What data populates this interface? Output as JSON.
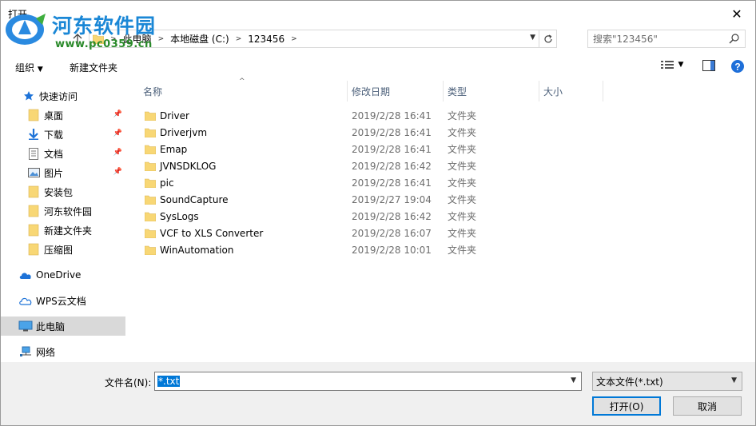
{
  "window": {
    "title": "打开",
    "close_glyph": "✕"
  },
  "watermark": {
    "name": "河东软件园",
    "url": "www.pc0359.cn"
  },
  "address": {
    "crumbs": [
      "此电脑",
      "本地磁盘 (C:)",
      "123456"
    ],
    "search_placeholder": "搜索\"123456\""
  },
  "toolbar": {
    "organize_label": "组织",
    "new_folder_label": "新建文件夹"
  },
  "sidebar": {
    "quick_access": "快速访问",
    "pinned": [
      {
        "label": "桌面",
        "icon": "folder-icon"
      },
      {
        "label": "下载",
        "icon": "download-icon"
      },
      {
        "label": "文档",
        "icon": "document-icon"
      },
      {
        "label": "图片",
        "icon": "picture-icon"
      }
    ],
    "folders": [
      "安装包",
      "河东软件园",
      "新建文件夹",
      "压缩图"
    ],
    "onedrive": "OneDrive",
    "wps": "WPS云文档",
    "this_pc": "此电脑",
    "network": "网络"
  },
  "columns": [
    "名称",
    "修改日期",
    "类型",
    "大小"
  ],
  "files": [
    {
      "name": "Driver",
      "date": "2019/2/28 16:41",
      "type": "文件夹"
    },
    {
      "name": "Driverjvm",
      "date": "2019/2/28 16:41",
      "type": "文件夹"
    },
    {
      "name": "Emap",
      "date": "2019/2/28 16:41",
      "type": "文件夹"
    },
    {
      "name": "JVNSDKLOG",
      "date": "2019/2/28 16:42",
      "type": "文件夹"
    },
    {
      "name": "pic",
      "date": "2019/2/28 16:41",
      "type": "文件夹"
    },
    {
      "name": "SoundCapture",
      "date": "2019/2/27 19:04",
      "type": "文件夹"
    },
    {
      "name": "SysLogs",
      "date": "2019/2/28 16:42",
      "type": "文件夹"
    },
    {
      "name": "VCF to XLS Converter",
      "date": "2019/2/28 16:07",
      "type": "文件夹"
    },
    {
      "name": "WinAutomation",
      "date": "2019/2/28 10:01",
      "type": "文件夹"
    }
  ],
  "bottom": {
    "filename_label": "文件名(N):",
    "filename_value": "*.txt",
    "filetype_value": "文本文件(*.txt)",
    "open_label": "打开(O)",
    "cancel_label": "取消"
  },
  "colors": {
    "accent": "#0078d7",
    "folder": "#f8d775",
    "selected_nav": "#d9d9d9",
    "watermark_blue": "#1a87d6",
    "watermark_green": "#2a8a2a"
  }
}
